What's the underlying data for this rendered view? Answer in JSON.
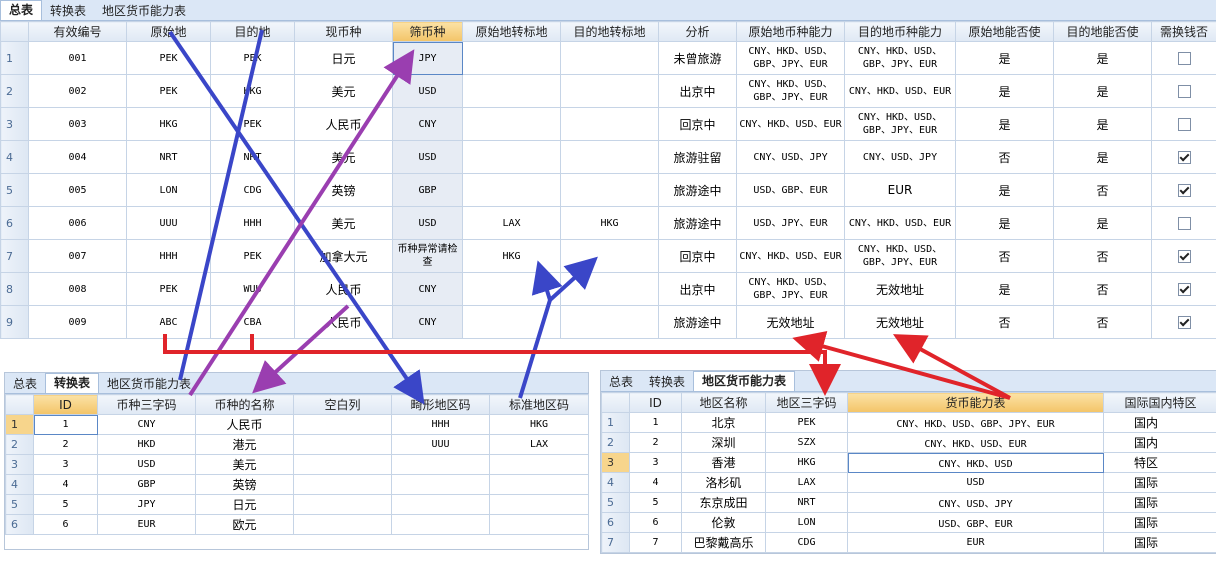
{
  "main": {
    "tabs": [
      "总表",
      "转换表",
      "地区货币能力表"
    ],
    "active_tab": 0,
    "headers": [
      "有效编号",
      "原始地",
      "目的地",
      "现币种",
      "筛币种",
      "原始地转标地",
      "目的地转标地",
      "分析",
      "原始地币种能力",
      "目的地币种能力",
      "原始地能否使",
      "目的地能否使",
      "需换钱否"
    ],
    "rows": [
      {
        "n": "1",
        "id": "001",
        "orig": "PEK",
        "dest": "PEK",
        "cur": "日元",
        "filter": "JPY",
        "ot": "",
        "dt": "",
        "analysis": "未曾旅游",
        "oc": "CNY、HKD、USD、GBP、JPY、EUR",
        "dc": "CNY、HKD、USD、GBP、JPY、EUR",
        "ou": "是",
        "du": "是",
        "ex": false
      },
      {
        "n": "2",
        "id": "002",
        "orig": "PEK",
        "dest": "HKG",
        "cur": "美元",
        "filter": "USD",
        "ot": "",
        "dt": "",
        "analysis": "出京中",
        "oc": "CNY、HKD、USD、GBP、JPY、EUR",
        "dc": "CNY、HKD、USD、EUR",
        "ou": "是",
        "du": "是",
        "ex": false
      },
      {
        "n": "3",
        "id": "003",
        "orig": "HKG",
        "dest": "PEK",
        "cur": "人民币",
        "filter": "CNY",
        "ot": "",
        "dt": "",
        "analysis": "回京中",
        "oc": "CNY、HKD、USD、EUR",
        "dc": "CNY、HKD、USD、GBP、JPY、EUR",
        "ou": "是",
        "du": "是",
        "ex": false
      },
      {
        "n": "4",
        "id": "004",
        "orig": "NRT",
        "dest": "NRT",
        "cur": "美元",
        "filter": "USD",
        "ot": "",
        "dt": "",
        "analysis": "旅游驻留",
        "oc": "CNY、USD、JPY",
        "dc": "CNY、USD、JPY",
        "ou": "否",
        "du": "是",
        "ex": true
      },
      {
        "n": "5",
        "id": "005",
        "orig": "LON",
        "dest": "CDG",
        "cur": "英镑",
        "filter": "GBP",
        "ot": "",
        "dt": "",
        "analysis": "旅游途中",
        "oc": "USD、GBP、EUR",
        "dc": "EUR",
        "ou": "是",
        "du": "否",
        "ex": true
      },
      {
        "n": "6",
        "id": "006",
        "orig": "UUU",
        "dest": "HHH",
        "cur": "美元",
        "filter": "USD",
        "ot": "LAX",
        "dt": "HKG",
        "analysis": "旅游途中",
        "oc": "USD、JPY、EUR",
        "dc": "CNY、HKD、USD、EUR",
        "ou": "是",
        "du": "是",
        "ex": false
      },
      {
        "n": "7",
        "id": "007",
        "orig": "HHH",
        "dest": "PEK",
        "cur": "加拿大元",
        "filter": "币种异常请检查",
        "ot": "HKG",
        "dt": "",
        "analysis": "回京中",
        "oc": "CNY、HKD、USD、EUR",
        "dc": "CNY、HKD、USD、GBP、JPY、EUR",
        "ou": "否",
        "du": "否",
        "ex": true
      },
      {
        "n": "8",
        "id": "008",
        "orig": "PEK",
        "dest": "WUU",
        "cur": "人民币",
        "filter": "CNY",
        "ot": "",
        "dt": "",
        "analysis": "出京中",
        "oc": "CNY、HKD、USD、GBP、JPY、EUR",
        "dc": "无效地址",
        "ou": "是",
        "du": "否",
        "ex": true
      },
      {
        "n": "9",
        "id": "009",
        "orig": "ABC",
        "dest": "CBA",
        "cur": "人民币",
        "filter": "CNY",
        "ot": "",
        "dt": "",
        "analysis": "旅游途中",
        "oc": "无效地址",
        "dc": "无效地址",
        "ou": "否",
        "du": "否",
        "ex": true
      }
    ]
  },
  "convert": {
    "tabs": [
      "总表",
      "转换表",
      "地区货币能力表"
    ],
    "active_tab": 1,
    "headers": [
      "ID",
      "币种三字码",
      "币种的名称",
      "空白列",
      "畸形地区码",
      "标准地区码"
    ],
    "rows": [
      {
        "n": "1",
        "id": "1",
        "code": "CNY",
        "name": "人民币",
        "blank": "",
        "bad": "HHH",
        "std": "HKG"
      },
      {
        "n": "2",
        "id": "2",
        "code": "HKD",
        "name": "港元",
        "blank": "",
        "bad": "UUU",
        "std": "LAX"
      },
      {
        "n": "3",
        "id": "3",
        "code": "USD",
        "name": "美元",
        "blank": "",
        "bad": "",
        "std": ""
      },
      {
        "n": "4",
        "id": "4",
        "code": "GBP",
        "name": "英镑",
        "blank": "",
        "bad": "",
        "std": ""
      },
      {
        "n": "5",
        "id": "5",
        "code": "JPY",
        "name": "日元",
        "blank": "",
        "bad": "",
        "std": ""
      },
      {
        "n": "6",
        "id": "6",
        "code": "EUR",
        "name": "欧元",
        "blank": "",
        "bad": "",
        "std": ""
      }
    ]
  },
  "region": {
    "tabs": [
      "总表",
      "转换表",
      "地区货币能力表"
    ],
    "active_tab": 2,
    "headers": [
      "ID",
      "地区名称",
      "地区三字码",
      "货币能力表",
      "国际国内特区"
    ],
    "rows": [
      {
        "n": "1",
        "id": "1",
        "name": "北京",
        "code": "PEK",
        "cap": "CNY、HKD、USD、GBP、JPY、EUR",
        "type": "国内"
      },
      {
        "n": "2",
        "id": "2",
        "name": "深圳",
        "code": "SZX",
        "cap": "CNY、HKD、USD、EUR",
        "type": "国内"
      },
      {
        "n": "3",
        "id": "3",
        "name": "香港",
        "code": "HKG",
        "cap": "CNY、HKD、USD",
        "type": "特区"
      },
      {
        "n": "4",
        "id": "4",
        "name": "洛杉矶",
        "code": "LAX",
        "cap": "USD",
        "type": "国际"
      },
      {
        "n": "5",
        "id": "5",
        "name": "东京成田",
        "code": "NRT",
        "cap": "CNY、USD、JPY",
        "type": "国际"
      },
      {
        "n": "6",
        "id": "6",
        "name": "伦敦",
        "code": "LON",
        "cap": "USD、GBP、EUR",
        "type": "国际"
      },
      {
        "n": "7",
        "id": "7",
        "name": "巴黎戴高乐",
        "code": "CDG",
        "cap": "EUR",
        "type": "国际"
      }
    ]
  },
  "colors": {
    "arrow_blue": "#3a46c8",
    "arrow_purple": "#9a3eb0",
    "arrow_red": "#e0242a",
    "header_highlight": "#f3c468",
    "tab_bar": "#dbe7f6"
  }
}
